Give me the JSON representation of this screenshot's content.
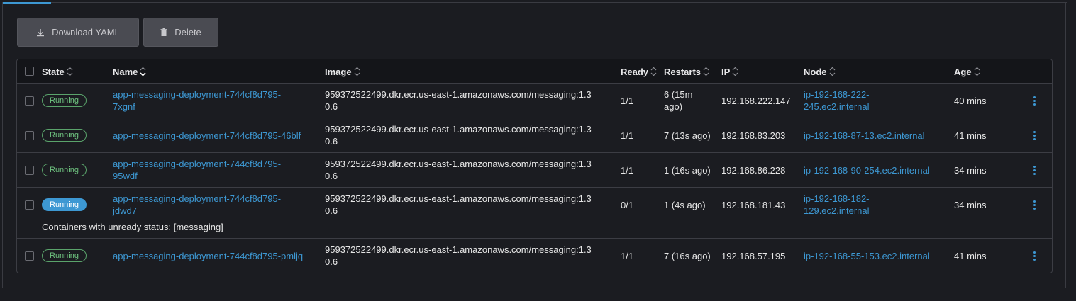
{
  "toolbar": {
    "download_label": "Download YAML",
    "delete_label": "Delete"
  },
  "table": {
    "columns": {
      "state": "State",
      "name": "Name",
      "image": "Image",
      "ready": "Ready",
      "restarts": "Restarts",
      "ip": "IP",
      "node": "Node",
      "age": "Age"
    },
    "rows": [
      {
        "state": "Running",
        "name_l1": "app-messaging-deployment-744cf8d795-",
        "name_l2": "7xgnf",
        "image_l1": "959372522499.dkr.ecr.us-east-1.amazonaws.com/messaging:1.3",
        "image_l2": "0.6",
        "ready": "1/1",
        "restarts_l1": "6 (15m",
        "restarts_l2": "ago)",
        "ip": "192.168.222.147",
        "node_l1": "ip-192-168-222-",
        "node_l2": "245.ec2.internal",
        "age": "40 mins"
      },
      {
        "state": "Running",
        "name_l1": "app-messaging-deployment-744cf8d795-46blf",
        "name_l2": "",
        "image_l1": "959372522499.dkr.ecr.us-east-1.amazonaws.com/messaging:1.3",
        "image_l2": "0.6",
        "ready": "1/1",
        "restarts_l1": "7 (13s ago)",
        "restarts_l2": "",
        "ip": "192.168.83.203",
        "node_l1": "ip-192-168-87-13.ec2.internal",
        "node_l2": "",
        "age": "41 mins"
      },
      {
        "state": "Running",
        "name_l1": "app-messaging-deployment-744cf8d795-",
        "name_l2": "95wdf",
        "image_l1": "959372522499.dkr.ecr.us-east-1.amazonaws.com/messaging:1.3",
        "image_l2": "0.6",
        "ready": "1/1",
        "restarts_l1": "1 (16s ago)",
        "restarts_l2": "",
        "ip": "192.168.86.228",
        "node_l1": "ip-192-168-90-254.ec2.internal",
        "node_l2": "",
        "age": "34 mins"
      },
      {
        "state": "Running",
        "name_l1": "app-messaging-deployment-744cf8d795-",
        "name_l2": "jdwd7",
        "image_l1": "959372522499.dkr.ecr.us-east-1.amazonaws.com/messaging:1.3",
        "image_l2": "0.6",
        "ready": "0/1",
        "restarts_l1": "1 (4s ago)",
        "restarts_l2": "",
        "ip": "192.168.181.43",
        "node_l1": "ip-192-168-182-",
        "node_l2": "129.ec2.internal",
        "age": "34 mins",
        "note": "Containers with unready status: [messaging]"
      },
      {
        "state": "Running",
        "name_l1": "app-messaging-deployment-744cf8d795-pmljq",
        "name_l2": "",
        "image_l1": "959372522499.dkr.ecr.us-east-1.amazonaws.com/messaging:1.3",
        "image_l2": "0.6",
        "ready": "1/1",
        "restarts_l1": "7 (16s ago)",
        "restarts_l2": "",
        "ip": "192.168.57.195",
        "node_l1": "ip-192-168-55-153.ec2.internal",
        "node_l2": "",
        "age": "41 mins"
      }
    ]
  },
  "colors": {
    "accent": "#3d98d3",
    "running_badge": "#6ec27f",
    "background": "#1b1c21"
  },
  "icons": {
    "download": "download-icon",
    "delete": "trash-icon",
    "sort": "sort-icon",
    "row_actions": "kebab-menu-icon"
  }
}
